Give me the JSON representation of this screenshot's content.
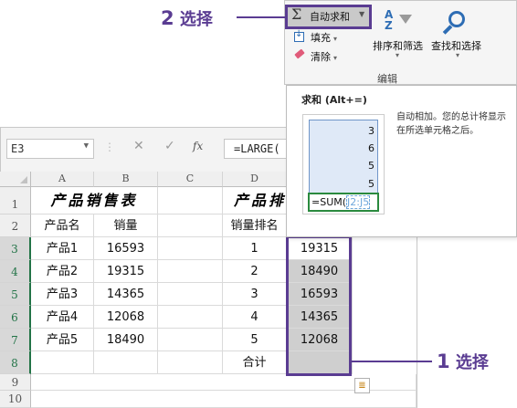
{
  "name_box": {
    "value": "E3"
  },
  "formula_bar": {
    "fx": "fx",
    "value": "=LARGE("
  },
  "columns": [
    "A",
    "B",
    "C",
    "D"
  ],
  "rows": [
    "1",
    "2",
    "3",
    "4",
    "5",
    "6",
    "7",
    "8",
    "9",
    "10"
  ],
  "table": {
    "title": "产品销售表",
    "title_right": "产品排",
    "headers": {
      "product": "产品名",
      "sales": "销量",
      "rank": "销量排名"
    },
    "records": [
      {
        "product": "产品1",
        "sales": "16593",
        "rank": "1",
        "sorted": "19315"
      },
      {
        "product": "产品2",
        "sales": "19315",
        "rank": "2",
        "sorted": "18490"
      },
      {
        "product": "产品3",
        "sales": "14365",
        "rank": "3",
        "sorted": "16593"
      },
      {
        "product": "产品4",
        "sales": "12068",
        "rank": "4",
        "sorted": "14365"
      },
      {
        "product": "产品5",
        "sales": "18490",
        "rank": "5",
        "sorted": "12068"
      }
    ],
    "total_label": "合计"
  },
  "ribbon": {
    "autosum": "自动求和",
    "fill": "填充",
    "clear": "清除",
    "sort_filter": "排序和筛选",
    "find_select": "查找和选择",
    "group": "编辑"
  },
  "tooltip": {
    "title": "求和 (Alt+=)",
    "description": "自动相加。您的总计将显示在所选单元格之后。",
    "example_values": [
      "3",
      "6",
      "5",
      "5"
    ],
    "example_formula": "=SUM(",
    "example_ref": "J2:J5"
  },
  "callouts": {
    "step1_num": "1",
    "step1_text": "选择",
    "step2_num": "2",
    "step2_text": "选择"
  },
  "colors": {
    "accent": "#5a3c92",
    "selected_fill": "#cfcfcf",
    "excel_green": "#217346"
  }
}
